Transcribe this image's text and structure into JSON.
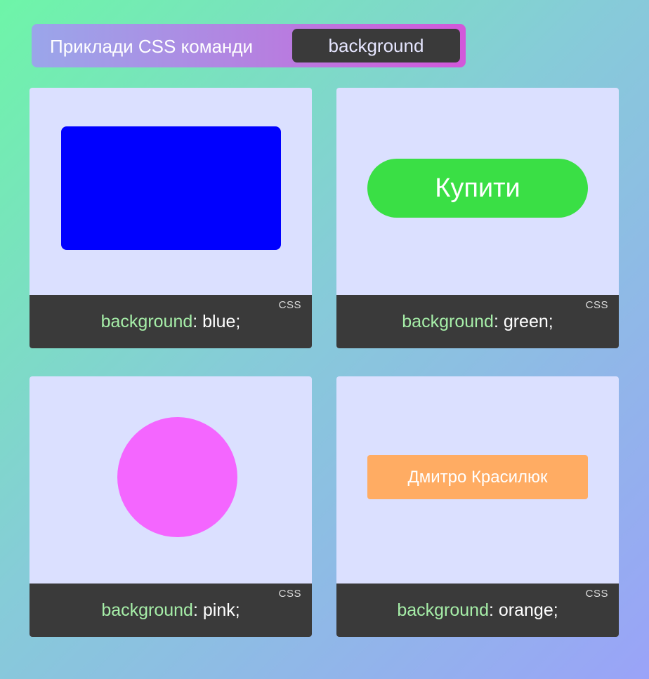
{
  "header": {
    "title": "Приклади CSS команди",
    "tag": "background"
  },
  "cards": [
    {
      "demo_kind": "rectangle",
      "demo_color": "#0000ff",
      "property": "background",
      "value": ": blue;",
      "code_label": "CSS"
    },
    {
      "demo_kind": "pill-button",
      "demo_color": "#3adf45",
      "demo_text": "Купити",
      "property": "background",
      "value": ": green;",
      "code_label": "CSS"
    },
    {
      "demo_kind": "circle",
      "demo_color": "#f466ff",
      "property": "background",
      "value": ": pink;",
      "code_label": "CSS"
    },
    {
      "demo_kind": "badge",
      "demo_color": "#ffac63",
      "demo_text": "Дмитро Красилюк",
      "property": "background",
      "value": ": orange;",
      "code_label": "CSS"
    }
  ]
}
